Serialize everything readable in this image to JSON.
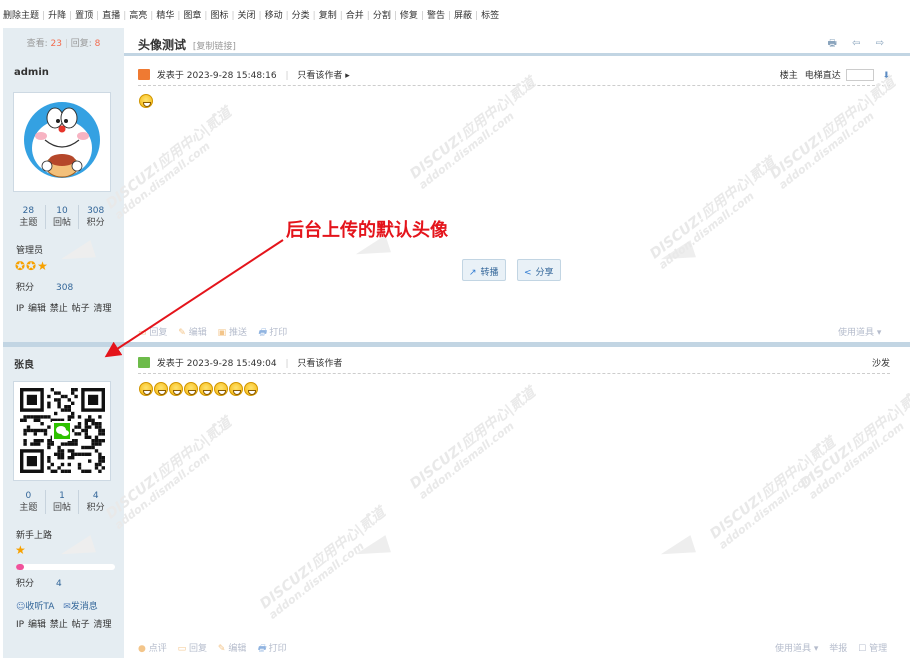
{
  "admin_toolbar": [
    "删除主题",
    "升降",
    "置顶",
    "直播",
    "高亮",
    "精华",
    "图章",
    "图标",
    "关闭",
    "移动",
    "分类",
    "复制",
    "合并",
    "分割",
    "修复",
    "警告",
    "屏蔽",
    "标签"
  ],
  "thread": {
    "views_label": "查看:",
    "views": "23",
    "replies_label": "回复:",
    "replies": "8",
    "title": "头像测试",
    "copy_link": "[复制链接]",
    "title_icons": "🖶 ⇦ ⇨"
  },
  "post1": {
    "author": "admin",
    "stats": [
      {
        "num": "28",
        "label": "主题"
      },
      {
        "num": "10",
        "label": "回帖"
      },
      {
        "num": "308",
        "label": "积分"
      }
    ],
    "group": "管理员",
    "stars": "✪✪★",
    "credit_label": "积分",
    "credit_value": "308",
    "ip_line": "IP 编辑 禁止 帖子 清理",
    "posted_at": "发表于 2023-9-28 15:48:16",
    "only_author": "只看该作者 ▸",
    "floor": "楼主",
    "jump_label": "电梯直达",
    "jump_arrow": "⬇",
    "share_retweet": "转播",
    "share_share": "分享",
    "actions": [
      "回复",
      "编辑",
      "推送",
      "打印"
    ],
    "use_tools": "使用道具 ▾"
  },
  "post2": {
    "author": "张良",
    "stats": [
      {
        "num": "0",
        "label": "主题"
      },
      {
        "num": "1",
        "label": "回帖"
      },
      {
        "num": "4",
        "label": "积分"
      }
    ],
    "group": "新手上路",
    "stars": "★",
    "progress": 0.08,
    "credit_label": "积分",
    "credit_value": "4",
    "follow": "收听TA",
    "message": "发消息",
    "ip_line": "IP 编辑 禁止 帖子 清理",
    "posted_at": "发表于 2023-9-28 15:49:04",
    "only_author": "只看该作者",
    "floor": "沙发",
    "emoji_count": 8,
    "actions": [
      "点评",
      "回复",
      "编辑",
      "打印"
    ],
    "use_tools": "使用道具 ▾",
    "report": "举报",
    "manage": "管理"
  },
  "annotation": {
    "text": "后台上传的默认头像",
    "color": "#e4141b"
  },
  "watermark": {
    "line1": "DISCUZ!应用中心|贰道",
    "line2": "addon.dismall.com"
  },
  "colors": {
    "sidebar_bg": "#e5edf2",
    "separator": "#c2d5e3",
    "accent_red": "#f26c4f",
    "link_blue": "#336699"
  }
}
